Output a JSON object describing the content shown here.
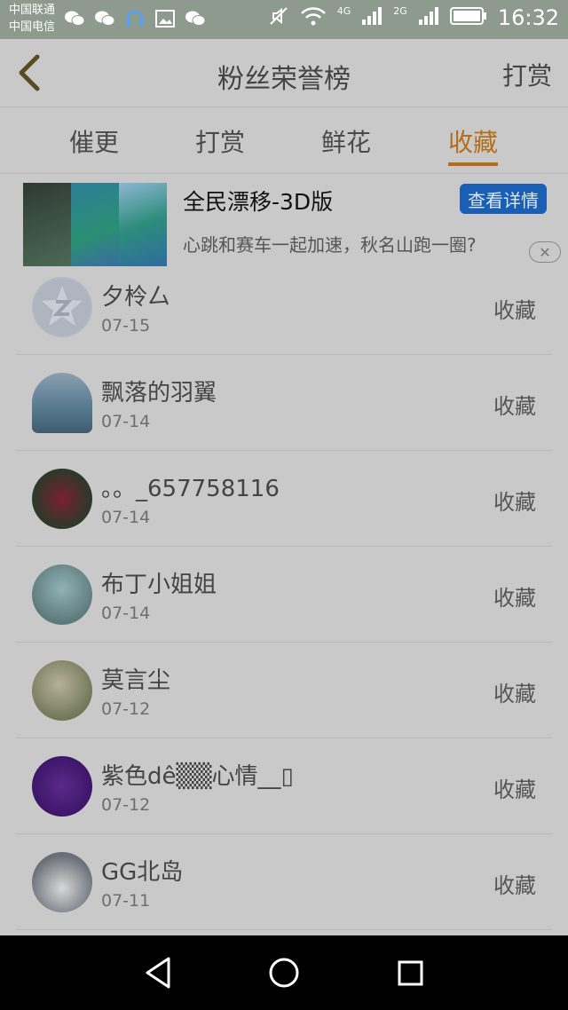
{
  "status_bar": {
    "carrier1": "中国联通",
    "carrier2": "中国电信",
    "net1": "4G",
    "net2": "2G",
    "time": "16:32",
    "icons_left": [
      "wechat-icon",
      "wechat-icon",
      "headset-icon",
      "image-icon",
      "wechat-icon"
    ],
    "icons_right": [
      "mute-icon",
      "wifi-icon",
      "signal-icon",
      "signal-icon",
      "battery-icon"
    ]
  },
  "header": {
    "title": "粉丝荣誉榜",
    "right_action": "打赏",
    "back_icon": "chevron-left-icon"
  },
  "tabs": [
    {
      "label": "催更",
      "active": false
    },
    {
      "label": "打赏",
      "active": false
    },
    {
      "label": "鲜花",
      "active": false
    },
    {
      "label": "收藏",
      "active": true
    }
  ],
  "ad": {
    "title": "全民漂移-3D版",
    "description": "心跳和赛车一起加速，秋名山跑一圈?",
    "button": "查看详情",
    "close_icon": "close-icon"
  },
  "fans": [
    {
      "name": "夕柃厶",
      "date": "07-15",
      "action": "收藏"
    },
    {
      "name": "飘落的羽翼",
      "date": "07-14",
      "action": "收藏"
    },
    {
      "name": "。。_657758116",
      "date": "07-14",
      "action": "收藏"
    },
    {
      "name": "布丁小姐姐",
      "date": "07-14",
      "action": "收藏"
    },
    {
      "name": "莫言尘",
      "date": "07-12",
      "action": "收藏"
    },
    {
      "name": "紫色dê▒▒心情__▯",
      "date": "07-12",
      "action": "收藏"
    },
    {
      "name": "GG北岛",
      "date": "07-11",
      "action": "收藏"
    }
  ],
  "colors": {
    "accent": "#b46e1a",
    "ad_button": "#1a5fb4",
    "overlay_bg": "#c9c9c9"
  },
  "nav_icons": [
    "back-triangle-icon",
    "home-circle-icon",
    "recents-square-icon"
  ]
}
